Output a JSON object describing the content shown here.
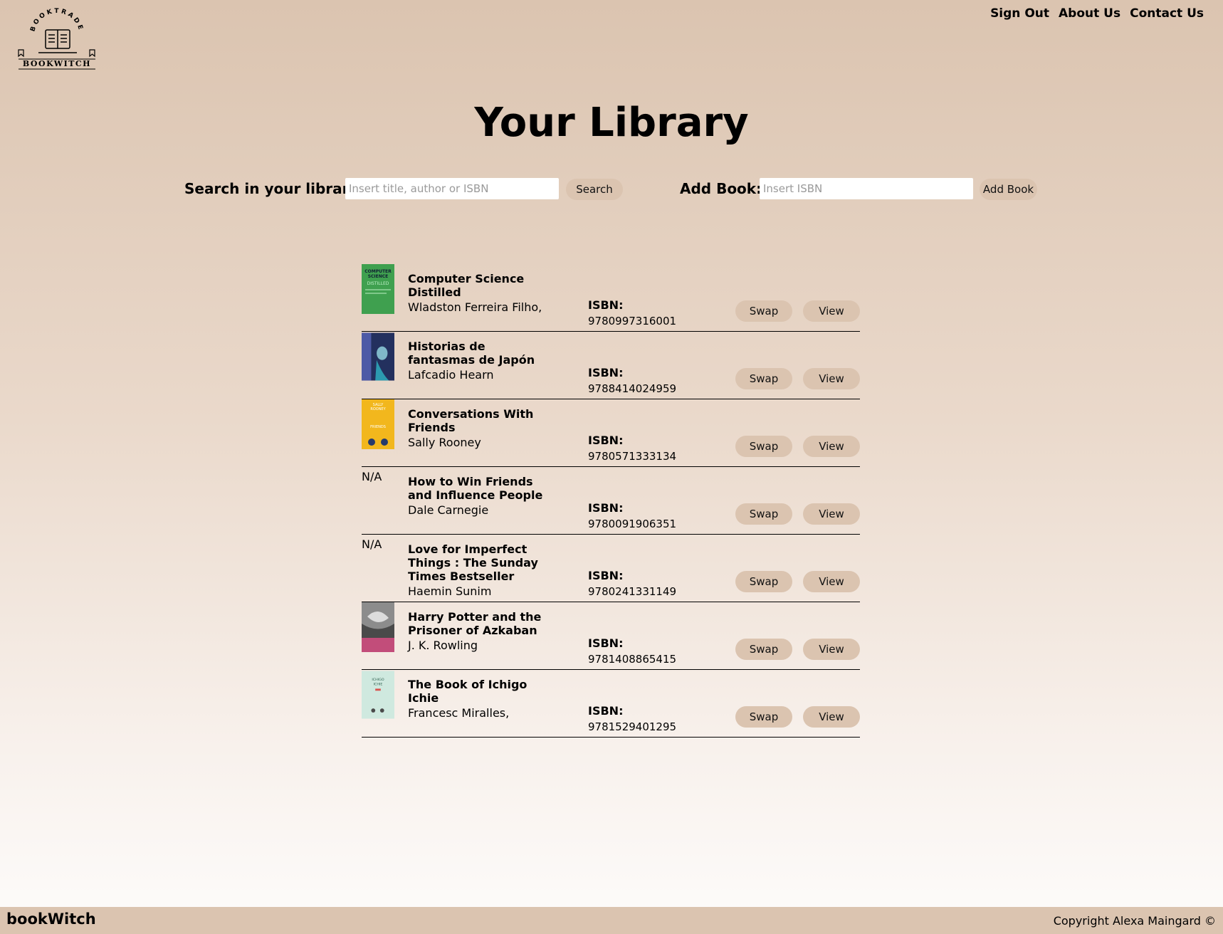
{
  "logo": {
    "arc_text": "BOOKTRADE",
    "name": "BOOKWITCH"
  },
  "nav": [
    {
      "label": "Sign Out"
    },
    {
      "label": "About Us"
    },
    {
      "label": "Contact Us"
    }
  ],
  "page_title": "Your Library",
  "search": {
    "label": "Search in your library:",
    "placeholder": "Insert title, author or ISBN",
    "button": "Search"
  },
  "add_book": {
    "label": "Add Book:",
    "placeholder": "Insert ISBN",
    "button": "Add Book"
  },
  "books": [
    {
      "title": "Computer Science Distilled",
      "author": "Wladston Ferreira Filho,",
      "isbn_label": "ISBN:",
      "isbn": "9780997316001",
      "cover": "green",
      "cover_color": "#3fa04f",
      "cover_text": "COMPUTER SCIENCE"
    },
    {
      "title": "Historias de fantasmas de Japón",
      "author": "Lafcadio Hearn",
      "isbn_label": "ISBN:",
      "isbn": "9788414024959",
      "cover": "dark-blue",
      "cover_color": "#23305e"
    },
    {
      "title": "Conversations With Friends",
      "author": "Sally Rooney",
      "isbn_label": "ISBN:",
      "isbn": "9780571333134",
      "cover": "yellow",
      "cover_color": "#f2b71d",
      "cover_text": "SALLY ROONEY"
    },
    {
      "title": "How to Win Friends and Influence People",
      "author": "Dale Carnegie",
      "isbn_label": "ISBN:",
      "isbn": "9780091906351",
      "cover": "none",
      "no_cover_text": "N/A"
    },
    {
      "title": "Love for Imperfect Things : The Sunday Times Bestseller",
      "author": "Haemin Sunim",
      "isbn_label": "ISBN:",
      "isbn": "9780241331149",
      "cover": "none",
      "no_cover_text": "N/A"
    },
    {
      "title": "Harry Potter and the Prisoner of Azkaban",
      "author": "J. K. Rowling",
      "isbn_label": "ISBN:",
      "isbn": "9781408865415",
      "cover": "grey",
      "cover_color": "#4a4a4a"
    },
    {
      "title": "The Book of Ichigo Ichie",
      "author": "Francesc Miralles,",
      "isbn_label": "ISBN:",
      "isbn": "9781529401295",
      "cover": "mint",
      "cover_color": "#cfe9df",
      "cover_text": "ICHIGO ICHIE"
    }
  ],
  "row_buttons": {
    "swap": "Swap",
    "view": "View"
  },
  "footer": {
    "brand": "bookWitch",
    "copyright": "Copyright Alexa Maingard ©"
  },
  "colors": {
    "accent": "#dbc4b0",
    "text": "#000000",
    "bg_bottom": "#fdfcfb"
  }
}
